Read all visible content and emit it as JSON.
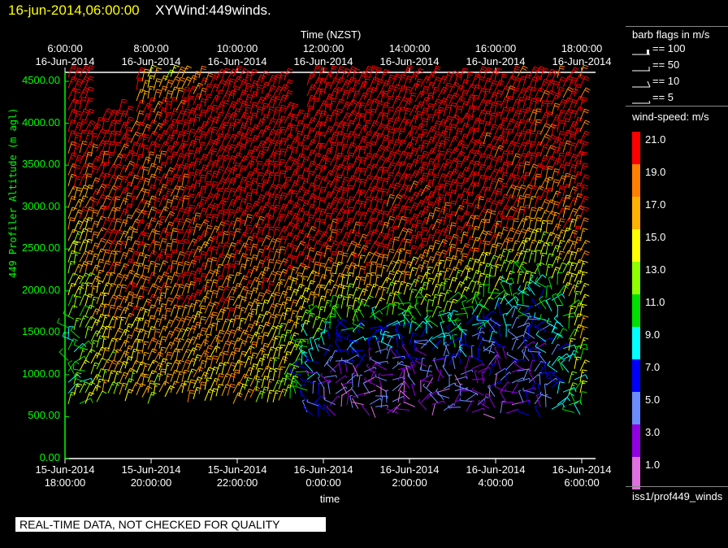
{
  "title": {
    "date": "16-jun-2014,06:00:00",
    "name": "XYWind:449winds."
  },
  "legend": {
    "barb_title": "barb flags in m/s",
    "barb_items": [
      "== 100",
      "== 50",
      "== 10",
      "== 5"
    ],
    "speed_title": "wind-speed: m/s",
    "source": "iss1/prof449_winds"
  },
  "footer": "REAL-TIME DATA, NOT CHECKED FOR QUALITY",
  "chart_data": {
    "type": "wind-barb",
    "top_axis_title": "Time (NZST)",
    "bottom_axis_title": "time",
    "ylabel": "449 Profiler Altitude (m agl)",
    "ylim": [
      0,
      4600
    ],
    "yticks": [
      "0.00",
      "500.00",
      "1000.00",
      "1500.00",
      "2000.00",
      "2500.00",
      "3000.00",
      "3500.00",
      "4000.00",
      "4500.00"
    ],
    "top_ticks": [
      {
        "time": "6:00:00",
        "date": "16-Jun-2014"
      },
      {
        "time": "8:00:00",
        "date": "16-Jun-2014"
      },
      {
        "time": "10:00:00",
        "date": "16-Jun-2014"
      },
      {
        "time": "12:00:00",
        "date": "16-Jun-2014"
      },
      {
        "time": "14:00:00",
        "date": "16-Jun-2014"
      },
      {
        "time": "16:00:00",
        "date": "16-Jun-2014"
      },
      {
        "time": "18:00:00",
        "date": "16-Jun-2014"
      }
    ],
    "bottom_ticks": [
      {
        "date": "15-Jun-2014",
        "time": "18:00:00"
      },
      {
        "date": "15-Jun-2014",
        "time": "20:00:00"
      },
      {
        "date": "15-Jun-2014",
        "time": "22:00:00"
      },
      {
        "date": "16-Jun-2014",
        "time": "0:00:00"
      },
      {
        "date": "16-Jun-2014",
        "time": "2:00:00"
      },
      {
        "date": "16-Jun-2014",
        "time": "4:00:00"
      },
      {
        "date": "16-Jun-2014",
        "time": "6:00:00"
      }
    ],
    "x_hours_utc_from_start": [
      0,
      1,
      2,
      3,
      4,
      5,
      6,
      7,
      8,
      9,
      10,
      11,
      12
    ],
    "altitudes_m": [
      500,
      1000,
      1500,
      2000,
      2500,
      3000,
      3500,
      4000,
      4500
    ],
    "speed_grid_m_s": [
      [
        12,
        14,
        15,
        16,
        16,
        14,
        4,
        3,
        3,
        4,
        3,
        4,
        12
      ],
      [
        10,
        16,
        16,
        17,
        17,
        15,
        4,
        3,
        3,
        4,
        4,
        5,
        14
      ],
      [
        8,
        17,
        18,
        18,
        18,
        15,
        10,
        8,
        8,
        10,
        6,
        6,
        15
      ],
      [
        12,
        18,
        19,
        19,
        19,
        18,
        16,
        16,
        15,
        14,
        12,
        10,
        16
      ],
      [
        15,
        19,
        20,
        20,
        20,
        21,
        22,
        21,
        21,
        20,
        18,
        15,
        18
      ],
      [
        18,
        21,
        20,
        22,
        22,
        23,
        23,
        22,
        22,
        22,
        21,
        18,
        21
      ],
      [
        21,
        22,
        21,
        24,
        24,
        24,
        24,
        23,
        23,
        23,
        22,
        21,
        22
      ],
      [
        22,
        23,
        20,
        25,
        26,
        24,
        24,
        24,
        23,
        23,
        22,
        22,
        22
      ],
      [
        22,
        22,
        16,
        17,
        25,
        24,
        24,
        24,
        23,
        23,
        22,
        22,
        22
      ]
    ],
    "color_scale": [
      {
        "label": "21.0",
        "color": "#ff0000"
      },
      {
        "label": "19.0",
        "color": "#ff8000"
      },
      {
        "label": "17.0",
        "color": "#ffb000"
      },
      {
        "label": "15.0",
        "color": "#ffff00"
      },
      {
        "label": "13.0",
        "color": "#90ff00"
      },
      {
        "label": "11.0",
        "color": "#00e000"
      },
      {
        "label": "9.0",
        "color": "#00ffff"
      },
      {
        "label": "7.0",
        "color": "#0000ff"
      },
      {
        "label": "5.0",
        "color": "#6a8cff"
      },
      {
        "label": "3.0",
        "color": "#9000e0"
      },
      {
        "label": "1.0",
        "color": "#e070e0"
      }
    ]
  }
}
